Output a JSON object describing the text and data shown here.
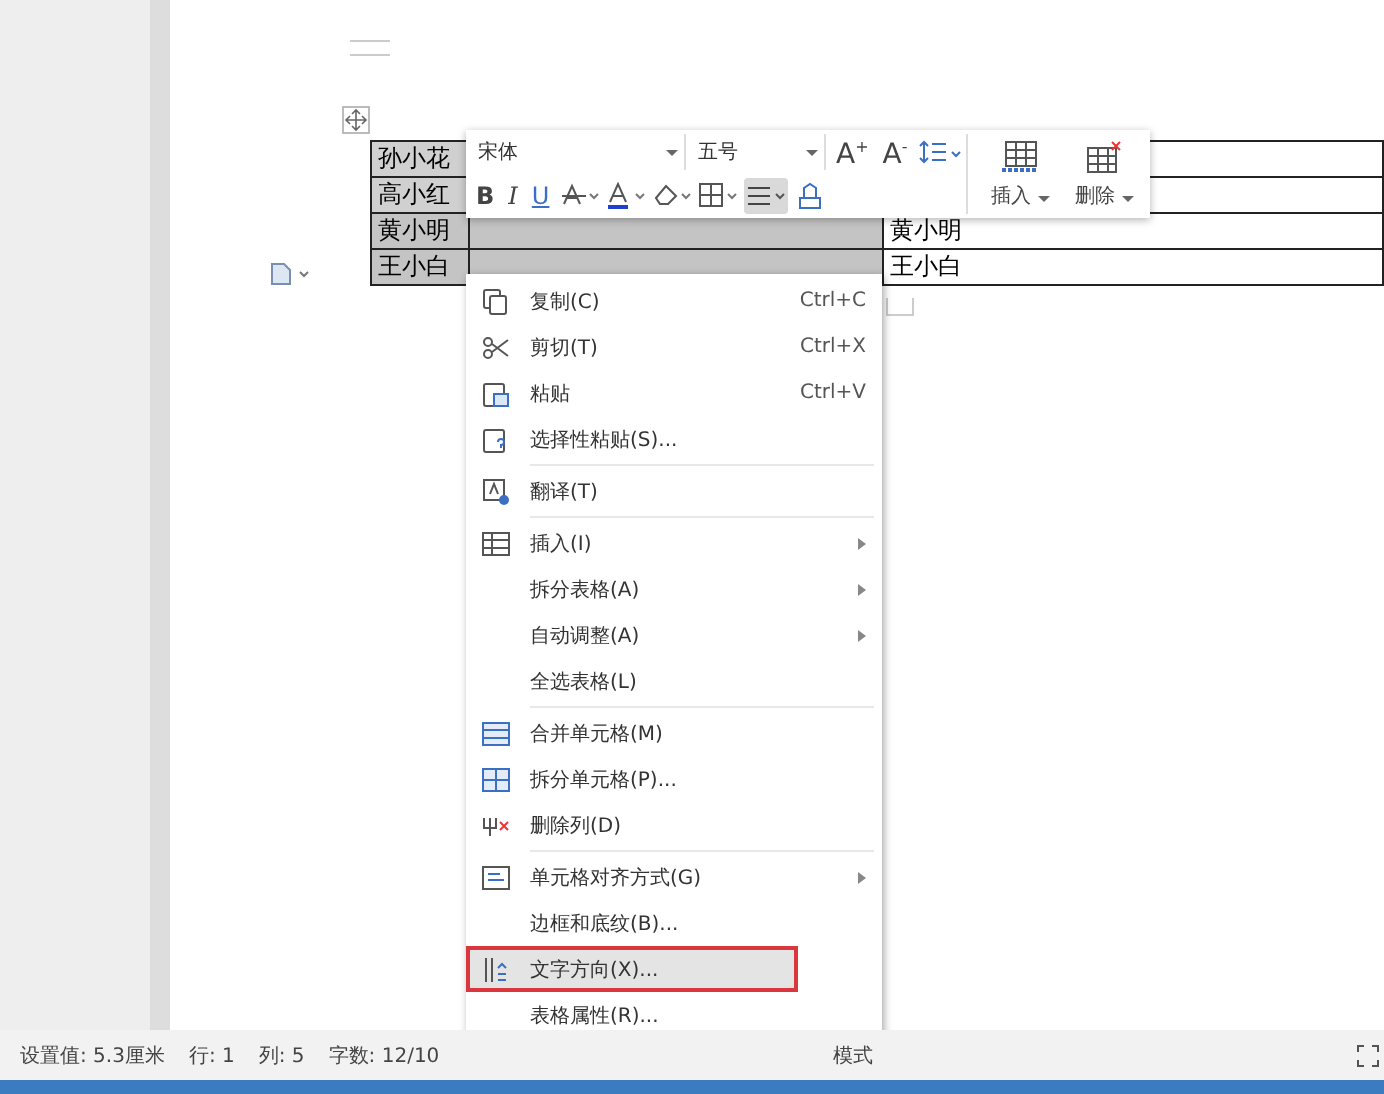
{
  "table": {
    "rows": [
      {
        "name": "孙小花",
        "selected": false,
        "column_3": ""
      },
      {
        "name": "高小红",
        "selected": false,
        "column_3": ""
      },
      {
        "name": "黄小明",
        "selected": true,
        "column_3": "黄小明"
      },
      {
        "name": "王小白",
        "selected": true,
        "column_3": "王小白"
      }
    ]
  },
  "toolbar": {
    "font": "宋体",
    "size": "五号",
    "grow_font": "A$^{+}$",
    "shrink_font": "A$^{-}$",
    "bold": "B",
    "italic": "I",
    "underline": "U",
    "insert": "插入",
    "delete": "删除",
    "align_selected": true
  },
  "context_menu": {
    "groups": [
      [
        {
          "label": "复制(C)",
          "shortcut": "Ctrl+C",
          "submenu": false,
          "selected": false,
          "marked": false
        },
        {
          "label": "剪切(T)",
          "shortcut": "Ctrl+X",
          "submenu": false,
          "selected": false,
          "marked": false
        },
        {
          "label": "粘贴",
          "shortcut": "Ctrl+V",
          "submenu": false,
          "selected": false,
          "marked": false
        },
        {
          "label": "选择性粘贴(S)...",
          "submenu": false,
          "selected": false,
          "marked": false
        }
      ],
      [
        {
          "label": "翻译(T)",
          "submenu": false,
          "selected": false,
          "marked": false
        }
      ],
      [
        {
          "label": "插入(I)",
          "submenu": true,
          "selected": false,
          "marked": false
        },
        {
          "label": "拆分表格(A)",
          "submenu": true,
          "selected": false,
          "marked": false
        },
        {
          "label": "自动调整(A)",
          "submenu": true,
          "selected": false,
          "marked": false
        },
        {
          "label": "全选表格(L)",
          "submenu": false,
          "selected": false,
          "marked": false
        }
      ],
      [
        {
          "label": "合并单元格(M)",
          "submenu": false,
          "selected": false,
          "marked": false
        },
        {
          "label": "拆分单元格(P)...",
          "submenu": false,
          "selected": false,
          "marked": false
        },
        {
          "label": "删除列(D)",
          "submenu": false,
          "selected": false,
          "marked": false
        }
      ],
      [
        {
          "label": "单元格对齐方式(G)",
          "submenu": true,
          "selected": false,
          "marked": false
        },
        {
          "label": "边框和底纹(B)...",
          "submenu": false,
          "selected": false,
          "marked": false
        },
        {
          "label": "文字方向(X)...",
          "submenu": false,
          "selected": true,
          "marked": true
        },
        {
          "label": "表格属性(R)...",
          "submenu": false,
          "selected": false,
          "marked": false
        }
      ]
    ]
  },
  "status_bar": {
    "items": [
      "设置值: 5.3厘米",
      "行: 1",
      "列: 5",
      "字数: 12/10"
    ],
    "mode": "模式"
  }
}
